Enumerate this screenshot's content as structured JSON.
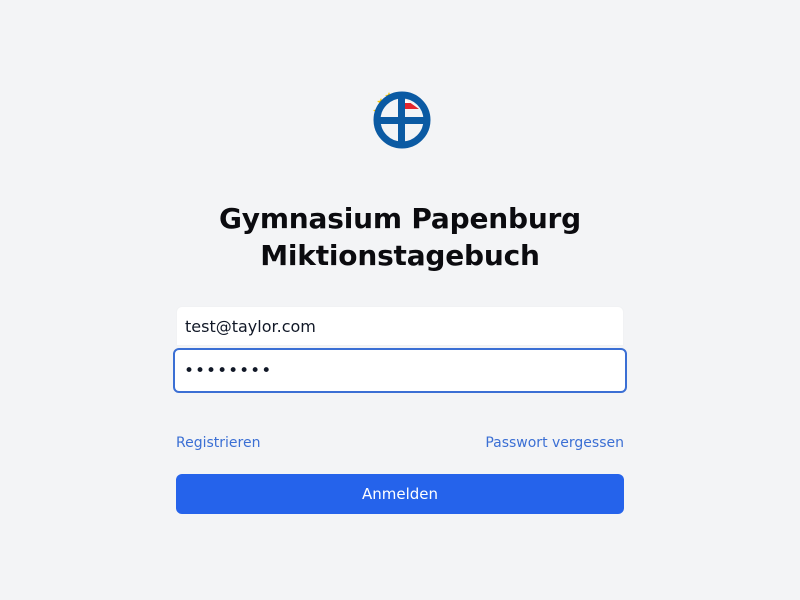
{
  "header": {
    "title_line1": "Gymnasium Papenburg",
    "title_line2": "Miktionstagebuch"
  },
  "logo": {
    "icon": "school-logo-icon",
    "colors": {
      "primary": "#0b5aa3",
      "stars": "#f5c400",
      "flag": "#e3262d"
    }
  },
  "login": {
    "email_value": "test@taylor.com",
    "password_value": "12345678",
    "register_label": "Registrieren",
    "forgot_label": "Passwort vergessen",
    "submit_label": "Anmelden"
  },
  "colors": {
    "background": "#f3f4f6",
    "accent": "#2563eb",
    "link": "#3b6fd4",
    "focus_border": "#3b6fd4"
  }
}
